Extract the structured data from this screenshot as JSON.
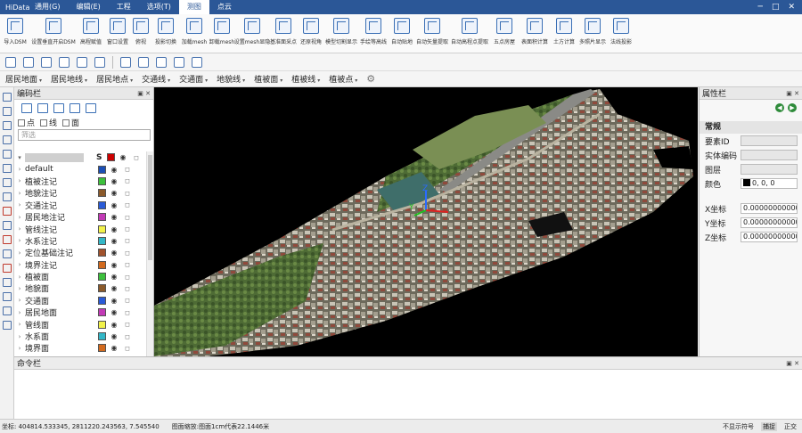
{
  "app": {
    "name": "HiData"
  },
  "menu": [
    {
      "label": "通用(G)",
      "active": false
    },
    {
      "label": "编辑(E)",
      "active": false
    },
    {
      "label": "工程",
      "active": false
    },
    {
      "label": "选项(T)",
      "active": false
    },
    {
      "label": "测图",
      "active": true
    },
    {
      "label": "点云",
      "active": false
    }
  ],
  "ribbon": [
    {
      "label": "导入DSM",
      "icon": "import-dsm-icon"
    },
    {
      "label": "设置垂直开启DSM",
      "icon": "dsm-settings-icon"
    },
    {
      "label": "高程赋值",
      "icon": "elevation-icon"
    },
    {
      "label": "窗口设置",
      "icon": "window-icon"
    },
    {
      "label": "俯视",
      "icon": "top-view-icon"
    },
    {
      "label": "投影切换",
      "icon": "projection-icon"
    },
    {
      "label": "加载mesh",
      "icon": "load-mesh-icon"
    },
    {
      "label": "卸载mesh",
      "icon": "unload-mesh-icon"
    },
    {
      "label": "设置mesh显隐",
      "icon": "mesh-visibility-icon"
    },
    {
      "label": "基准面采点",
      "icon": "base-plane-icon"
    },
    {
      "label": "还原视角",
      "icon": "reset-view-icon"
    },
    {
      "label": "模型切割显示",
      "icon": "model-clip-icon"
    },
    {
      "label": "手绘等高线",
      "icon": "contour-icon"
    },
    {
      "label": "自动贴地",
      "icon": "snap-ground-icon"
    },
    {
      "label": "自动矢量提取",
      "icon": "vector-extract-icon"
    },
    {
      "label": "自动高程点提取",
      "icon": "elevation-point-icon"
    },
    {
      "label": "五点房屋",
      "icon": "house-icon"
    },
    {
      "label": "表面积计算",
      "icon": "area-icon"
    },
    {
      "label": "土方计算",
      "icon": "earthwork-icon"
    },
    {
      "label": "多照片显示",
      "icon": "photos-icon"
    },
    {
      "label": "法线投影",
      "icon": "normal-projection-icon"
    }
  ],
  "dropdowns": [
    "居民地面",
    "居民地线",
    "居民地点",
    "交通线",
    "交通面",
    "地貌线",
    "植被面",
    "植被线",
    "植被点"
  ],
  "layer_panel": {
    "title": "编码栏",
    "filters": [
      "点",
      "线",
      "面"
    ],
    "search_placeholder": "筛选",
    "header_s": "S",
    "layers": [
      {
        "name": "default",
        "color": "#1c4fb5"
      },
      {
        "name": "植被注记",
        "color": "#3cc03c"
      },
      {
        "name": "地貌注记",
        "color": "#8b5a2b"
      },
      {
        "name": "交通注记",
        "color": "#2a5bd7"
      },
      {
        "name": "居民地注记",
        "color": "#c23ab6"
      },
      {
        "name": "管线注记",
        "color": "#f2f24a"
      },
      {
        "name": "水系注记",
        "color": "#33b7c7"
      },
      {
        "name": "定位基础注记",
        "color": "#a0522d"
      },
      {
        "name": "境界注记",
        "color": "#d26a1e"
      },
      {
        "name": "植被面",
        "color": "#3cc03c"
      },
      {
        "name": "地貌面",
        "color": "#8b5a2b"
      },
      {
        "name": "交通面",
        "color": "#2a5bd7"
      },
      {
        "name": "居民地面",
        "color": "#c23ab6"
      },
      {
        "name": "管线面",
        "color": "#f2f24a"
      },
      {
        "name": "水系面",
        "color": "#33b7c7"
      },
      {
        "name": "境界面",
        "color": "#d26a1e"
      }
    ]
  },
  "property_panel": {
    "title": "属性栏",
    "section": "常规",
    "fields": [
      {
        "key": "要素ID",
        "value": ""
      },
      {
        "key": "实体编码",
        "value": ""
      },
      {
        "key": "图层",
        "value": ""
      },
      {
        "key": "颜色",
        "value": "0, 0, 0"
      },
      {
        "key": "X坐标",
        "value": "0.000000000000"
      },
      {
        "key": "Y坐标",
        "value": "0.000000000000"
      },
      {
        "key": "Z坐标",
        "value": "0.000000000000"
      }
    ]
  },
  "command_panel": {
    "title": "命令栏"
  },
  "status": {
    "coords": "坐标: 404814.533345, 2811220.243563, 7.545540",
    "scale": "图面缩放:图面1cm代表22.1446米",
    "snap_off": "不显示符号",
    "capture": "捕捉",
    "ortho": "正交"
  }
}
